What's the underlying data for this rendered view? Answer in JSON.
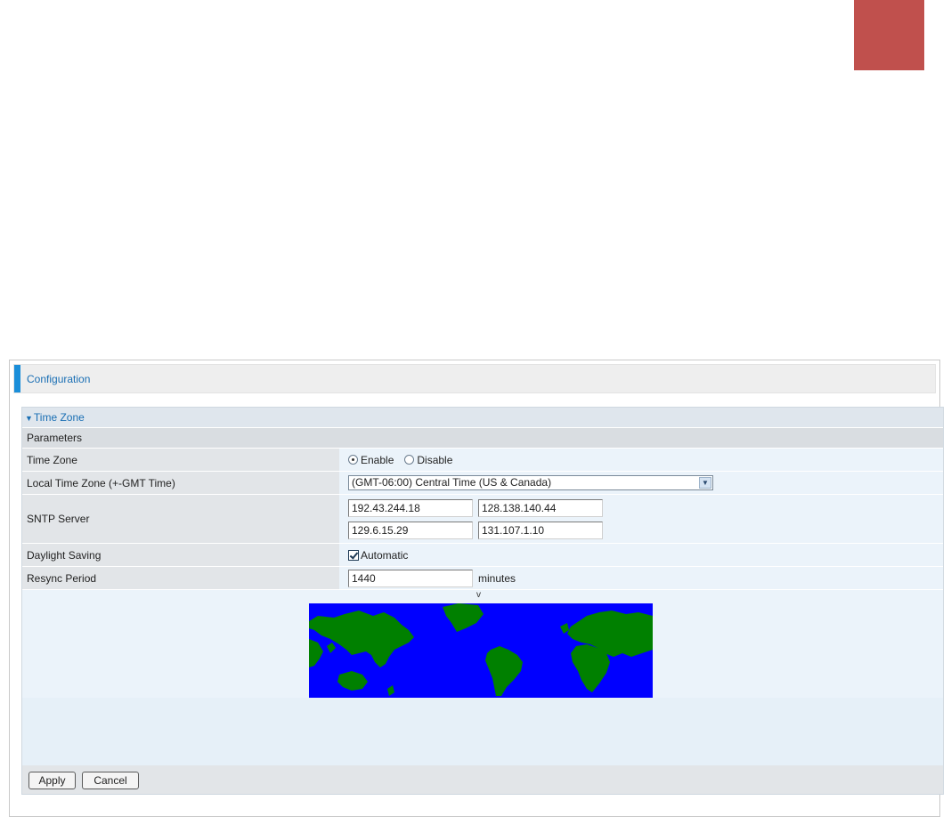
{
  "header": {
    "title": "Configuration"
  },
  "panel": {
    "title": "Time Zone",
    "section_title": "Parameters",
    "time_zone": {
      "label": "Time Zone",
      "options": [
        "Enable",
        "Disable"
      ],
      "selected": "Enable"
    },
    "local_time_zone": {
      "label": "Local Time Zone (+-GMT Time)",
      "value": "(GMT-06:00) Central Time (US & Canada)"
    },
    "sntp": {
      "label": "SNTP Server",
      "servers": [
        "192.43.244.18",
        "128.138.140.44",
        "129.6.15.29",
        "131.107.1.10"
      ]
    },
    "daylight": {
      "label": "Daylight Saving",
      "checkbox_label": "Automatic",
      "checked": true
    },
    "resync": {
      "label": "Resync Period",
      "value": "1440",
      "unit": "minutes"
    },
    "map": {
      "marker": "v"
    }
  },
  "buttons": {
    "apply": "Apply",
    "cancel": "Cancel"
  },
  "colors": {
    "accent": "#1a8ed9",
    "title": "#1a6fb4",
    "map_ocean": "#0000ff",
    "map_land": "#008000",
    "red_block": "#c0504d"
  }
}
